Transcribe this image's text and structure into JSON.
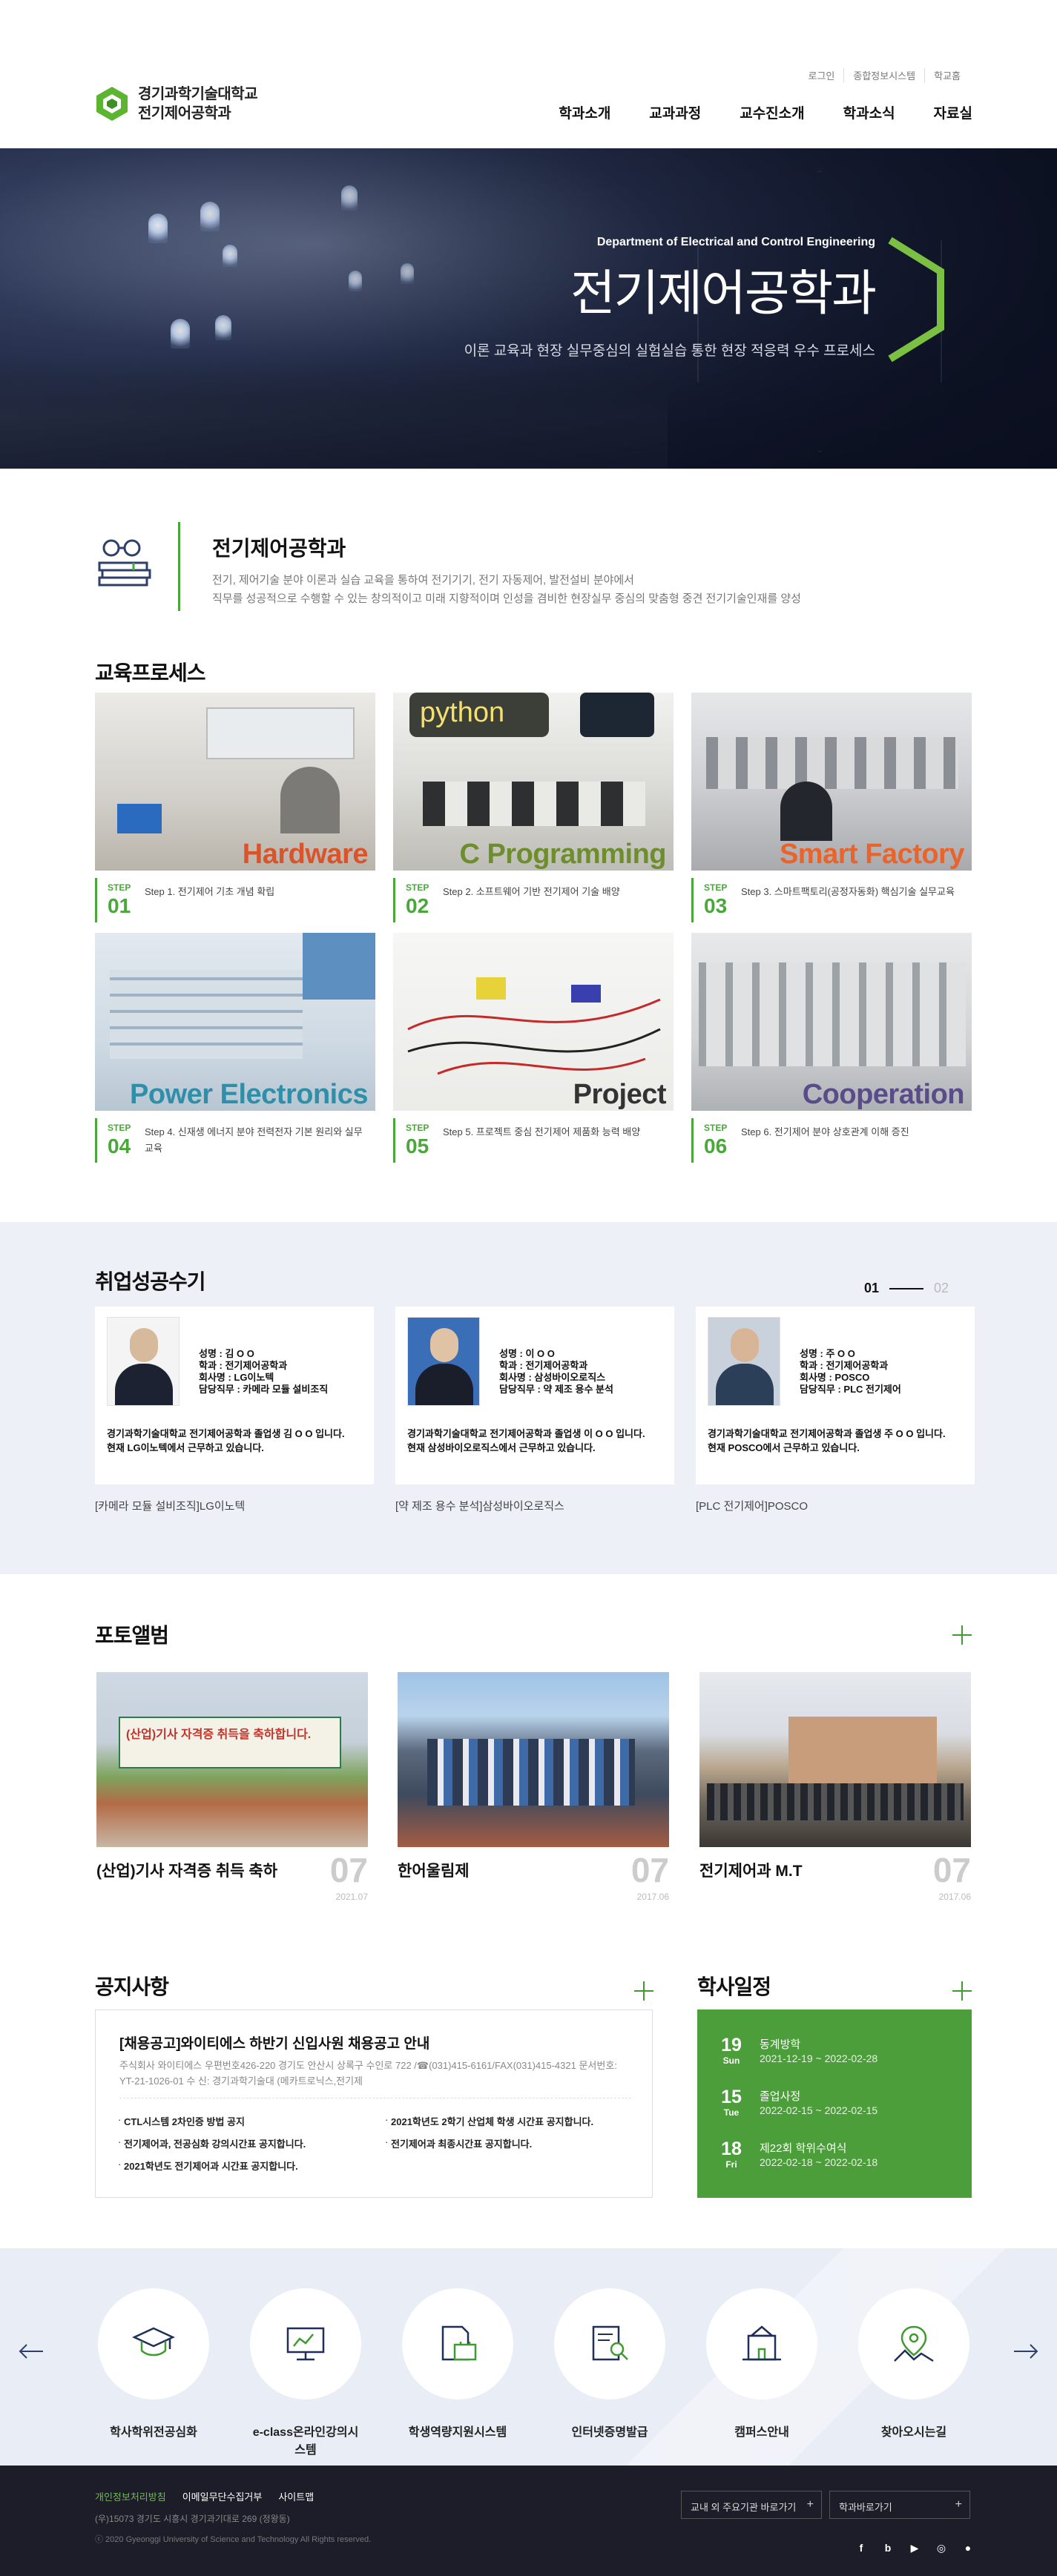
{
  "header": {
    "logo_line1": "경기과학기술대학교",
    "logo_line2": "전기제어공학과",
    "util": [
      "로그인",
      "종합정보시스템",
      "학교홈"
    ],
    "nav": [
      "학과소개",
      "교과과정",
      "교수진소개",
      "학과소식",
      "자료실"
    ]
  },
  "visual": {
    "en_title": "Department of Electrical and Control Engineering",
    "title": "전기제어공학과",
    "subtitle": "이론 교육과 현장 실무중심의 실험실습 통한 현장 적응력 우수 프로세스",
    "accent": "#7bc043"
  },
  "intro": {
    "title": "전기제어공학과",
    "desc1": "전기, 제어기술 분야 이론과 실습 교육을 통하여 전기기기, 전기 자동제어, 발전설비 분야에서",
    "desc2": "직무를 성공적으로 수행할 수 있는 창의적이고 미래 지향적이며 인성을 겸비한 현장실무 중심의 맞춤형 중견 전기기술인재를 양성"
  },
  "education": {
    "title": "교육프로세스",
    "step_label": "STEP",
    "cards": [
      {
        "label": "Hardware",
        "label_color": "#d9542b",
        "no": "01",
        "text": "Step 1. 전기제어 기초 개념 확립"
      },
      {
        "label": "C Programming",
        "label_color": "#6e8e2d",
        "no": "02",
        "text": "Step 2. 소프트웨어 기반 전기제어 기술 배양",
        "python": "python"
      },
      {
        "label": "Smart Factory",
        "label_color": "#e8642b",
        "no": "03",
        "text": "Step 3. 스마트팩토리(공정자동화) 핵심기술 실무교육"
      },
      {
        "label": "Power Electronics",
        "label_color": "#2f8fa8",
        "no": "04",
        "text": "Step 4. 신재생 에너지 분야 전력전자 기본 원리와 실무교육"
      },
      {
        "label": "Project",
        "label_color": "#333333",
        "no": "05",
        "text": "Step 5. 프로젝트 중심 전기제어 제품화 능력 배양"
      },
      {
        "label": "Cooperation",
        "label_color": "#5a4c8a",
        "no": "06",
        "text": "Step 6. 전기제어 분야 상호관계 이해 증진"
      }
    ]
  },
  "employment": {
    "title": "취업성공수기",
    "page_current": "01",
    "page_total": "02",
    "cards": [
      {
        "name": "성명 : 김 O O",
        "dept": "학과 : 전기제어공학과",
        "company": "회사명 : LG이노텍",
        "duty": "담당직무 : 카메라 모듈 설비조직",
        "q1": "경기과학기술대학교 전기제어공학과 졸업생 김 O O 입니다.",
        "q2": "현재 LG이노텍에서 근무하고 있습니다.",
        "caption": "[카메라 모듈 설비조직]LG이노텍"
      },
      {
        "name": "성명 : 이 O O",
        "dept": "학과 : 전기제어공학과",
        "company": "회사명 : 삼성바이오로직스",
        "duty": "담당직무 : 약 제조 용수 분석",
        "q1": "경기과학기술대학교 전기제어공학과 졸업생 이 O O 입니다.",
        "q2": "현재 삼성바이오로직스에서 근무하고 있습니다.",
        "caption": "[약 제조 용수 분석]삼성바이오로직스"
      },
      {
        "name": "성명 : 주 O O",
        "dept": "학과 : 전기제어공학과",
        "company": "회사명 : POSCO",
        "duty": "담당직무 : PLC 전기제어",
        "q1": "경기과학기술대학교 전기제어공학과 졸업생 주 O O 입니다.",
        "q2": "현재 POSCO에서 근무하고 있습니다.",
        "caption": "[PLC 전기제어]POSCO"
      }
    ]
  },
  "photo": {
    "title": "포토앨범",
    "cards": [
      {
        "title": "(산업)기사 자격증 취득 축하",
        "day": "07",
        "ym": "2021.07",
        "banner": "(산업)기사 자격증 취득을 축하합니다."
      },
      {
        "title": "한어울림제",
        "day": "07",
        "ym": "2017.06"
      },
      {
        "title": "전기제어과 M.T",
        "day": "07",
        "ym": "2017.06"
      }
    ]
  },
  "notice": {
    "title": "공지사항",
    "headline": "[채용공고]와이티에스 하반기 신입사원 채용공고 안내",
    "body": "주식회사 와이티에스   우편번호426-220  경기도 안산시 상록구 수인로 722  /☎(031)415-6161/FAX(031)415-4321     문서번호: YT-21-1026-01  수    신: 경기과학기술대 (메카트로닉스,전기제",
    "items": [
      "CTL시스템 2차인증 방법 공지",
      "2021학년도 2학기 산업체 학생 시간표 공지합니다.",
      "전기제어과, 전공심화 강의시간표 공지합니다.",
      "전기제어과 최종시간표 공지합니다.",
      "2021학년도 전기제어과 시간표 공지합니다."
    ]
  },
  "calendar": {
    "title": "학사일정",
    "items": [
      {
        "day": "19",
        "dow": "Sun",
        "title": "동계방학",
        "range": "2021-12-19 ~ 2022-02-28"
      },
      {
        "day": "15",
        "dow": "Tue",
        "title": "졸업사정",
        "range": "2022-02-15 ~ 2022-02-15"
      },
      {
        "day": "18",
        "dow": "Fri",
        "title": "제22회 학위수여식",
        "range": "2022-02-18 ~ 2022-02-18"
      }
    ]
  },
  "quick": {
    "items": [
      {
        "label": "학사학위전공심화",
        "icon": "graduation-cap-icon"
      },
      {
        "label": "e-class온라인강의시스템",
        "icon": "monitor-icon"
      },
      {
        "label": "학생역량지원시스템",
        "icon": "document-briefcase-icon"
      },
      {
        "label": "인터넷증명발급",
        "icon": "certificate-search-icon"
      },
      {
        "label": "캠퍼스안내",
        "icon": "campus-building-icon"
      },
      {
        "label": "찾아오시는길",
        "icon": "map-pin-icon"
      }
    ]
  },
  "footer": {
    "links": [
      "개인정보처리방침",
      "이메일무단수집거부",
      "사이트맵"
    ],
    "address": "(우)15073 경기도 시흥시 경기과기대로 269 (정왕동)",
    "copyright": "ⓒ 2020 Gyeonggi University of Science and Technology All Rights reserved.",
    "select1": "교내 외 주요기관 바로가기",
    "select2": "학과바로가기",
    "sns": [
      "f",
      "b",
      "▶",
      "◎",
      "●"
    ]
  }
}
